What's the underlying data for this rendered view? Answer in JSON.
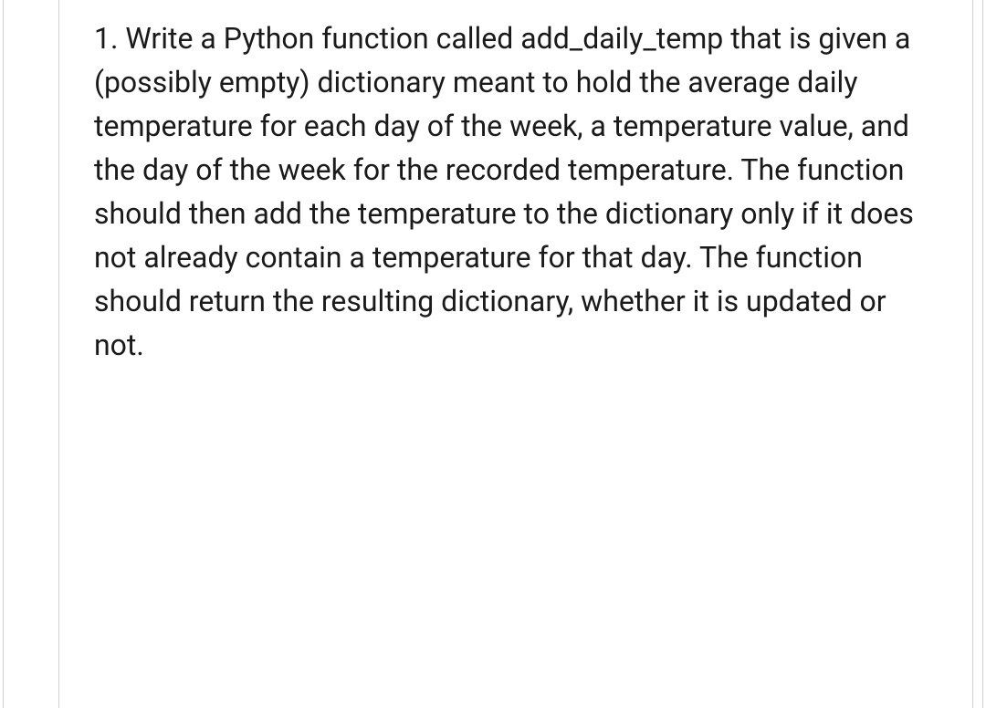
{
  "question": {
    "text": "1. Write a Python function called add_daily_temp that is given a (possibly empty) dictionary meant to hold the average daily temperature for each day of the week, a temperature value, and the day of the week for the recorded temperature. The function should then add the temperature to the dictionary only if it does not already contain a temperature for that day. The function should return the resulting dictionary, whether it is updated or not."
  }
}
